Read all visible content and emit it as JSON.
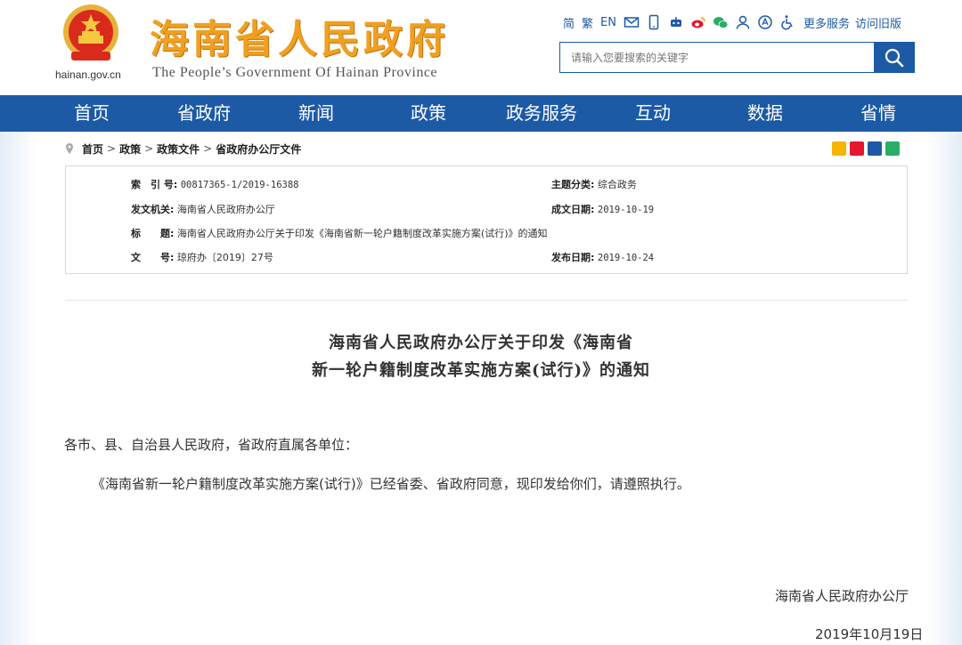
{
  "site": {
    "domain": "hainan.gov.cn",
    "title": "海南省人民政府",
    "subtitle": "The People’s Government Of Hainan Province"
  },
  "toolbar": {
    "lang_simplified": "简",
    "lang_traditional": "繁",
    "lang_en": "EN",
    "more_services": "更多服务",
    "old_version": "访问旧版",
    "icons": [
      "mail-icon",
      "mobile-icon",
      "robot-icon",
      "weibo-icon",
      "wechat-icon",
      "user-icon",
      "accessibility-icon",
      "wheelchair-icon"
    ]
  },
  "search": {
    "placeholder": "请输入您要搜索的关键字"
  },
  "nav": {
    "items": [
      "首页",
      "省政府",
      "新闻",
      "政策",
      "政务服务",
      "互动",
      "数据",
      "省情"
    ]
  },
  "breadcrumb": {
    "items": [
      "首页",
      "政策",
      "政策文件",
      "省政府办公厅文件"
    ],
    "separator": ">"
  },
  "meta": {
    "index_label": "索　引 号:",
    "index_value": "00817365-1/2019-16388",
    "category_label": "主题分类:",
    "category_value": "综合政务",
    "issuer_label": "发文机关:",
    "issuer_value": "海南省人民政府办公厅",
    "date_label": "成文日期:",
    "date_value": "2019-10-19",
    "title_label": "标　　题:",
    "title_value": "海南省人民政府办公厅关于印发《海南省新一轮户籍制度改革实施方案(试行)》的通知",
    "docno_label": "文　　号:",
    "docno_value": "琼府办〔2019〕27号",
    "publish_label": "发布日期:",
    "publish_value": "2019-10-24"
  },
  "document": {
    "title_line1": "海南省人民政府办公厅关于印发《海南省",
    "title_line2": "新一轮户籍制度改革实施方案(试行)》的通知",
    "salutation": "各市、县、自治县人民政府，省政府直属各单位：",
    "body": "《海南省新一轮户籍制度改革实施方案(试行)》已经省委、省政府同意，现印发给你们，请遵照执行。",
    "signature": "海南省人民政府办公厅",
    "date": "2019年10月19日"
  },
  "colors": {
    "brand_blue": "#1c5aa6",
    "title_orange": "#f0a020"
  }
}
